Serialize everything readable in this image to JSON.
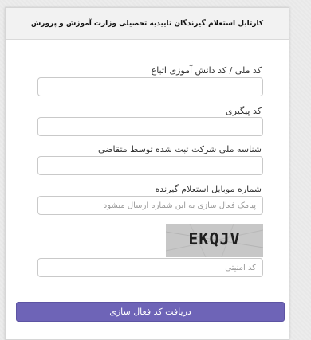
{
  "header": {
    "title": "کارتابل استعلام گیرندگان تاییدیه تحصیلی وزارت آموزش و پرورش"
  },
  "form": {
    "national_code": {
      "label": "کد ملی / کد دانش آموزی اتباع",
      "value": "",
      "placeholder": ""
    },
    "tracking_code": {
      "label": "کد پیگیری",
      "value": "",
      "placeholder": ""
    },
    "company_id": {
      "label": "شناسه ملی شرکت ثبت شده توسط متقاضی",
      "value": "",
      "placeholder": ""
    },
    "mobile": {
      "label": "شماره موبایل استعلام گیرنده",
      "value": "",
      "placeholder": "پیامک فعال سازی به این شماره ارسال میشود"
    },
    "captcha": {
      "text": "EKQJV"
    },
    "security_code": {
      "value": "",
      "placeholder": "کد امنیتی"
    },
    "submit_label": "دریافت کد فعال سازی"
  },
  "colors": {
    "accent": "#6e64b7",
    "panel_header": "#f2f2f2",
    "captcha_bg": "#c7c7c7"
  }
}
